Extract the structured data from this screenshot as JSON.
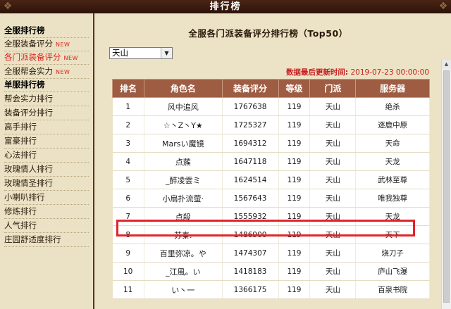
{
  "header": {
    "title": "排行榜"
  },
  "sidebar": {
    "items": [
      {
        "label": "全服排行榜",
        "head": true
      },
      {
        "label": "全服装备评分",
        "new": "NEW"
      },
      {
        "label": "各门派装备评分",
        "new": "NEW",
        "active": true
      },
      {
        "label": "全服帮会实力",
        "new": "NEW"
      },
      {
        "label": "单服排行榜",
        "head": true
      },
      {
        "label": "帮会实力排行"
      },
      {
        "label": "装备评分排行"
      },
      {
        "label": "高手排行"
      },
      {
        "label": "富豪排行"
      },
      {
        "label": "心法排行"
      },
      {
        "label": "玫瑰情人排行"
      },
      {
        "label": "玫瑰情圣排行"
      },
      {
        "label": "小喇叭排行"
      },
      {
        "label": "修炼排行"
      },
      {
        "label": "人气排行"
      },
      {
        "label": "庄园舒适度排行"
      }
    ]
  },
  "main": {
    "title": "全服各门派装备评分排行榜（Top50）",
    "sect_select": {
      "value": "天山"
    },
    "update_label": "数据最后更新时间:",
    "update_time": " 2019-07-23 00:00:00",
    "table": {
      "headers": [
        "排名",
        "角色名",
        "装备评分",
        "等级",
        "门派",
        "服务器"
      ],
      "rows": [
        [
          "1",
          "风中追风",
          "1767638",
          "119",
          "天山",
          "绝杀"
        ],
        [
          "2",
          "☆丶Z丶Y★",
          "1725327",
          "119",
          "天山",
          "逐鹿中原"
        ],
        [
          "3",
          "Marsい魔镜",
          "1694312",
          "119",
          "天山",
          "天命"
        ],
        [
          "4",
          "点蔟",
          "1647118",
          "119",
          "天山",
          "天龙"
        ],
        [
          "5",
          "_醉凌雲ミ",
          "1624514",
          "119",
          "天山",
          "武林至尊"
        ],
        [
          "6",
          "小扇扑流萤·",
          "1567643",
          "119",
          "天山",
          "唯我独尊"
        ],
        [
          "7",
          "点殺",
          "1555932",
          "119",
          "天山",
          "天龙"
        ],
        [
          "8",
          "苏秦.",
          "1486900",
          "119",
          "天山",
          "天下"
        ],
        [
          "9",
          "百里弥凉。や",
          "1474307",
          "119",
          "天山",
          "烧刀子"
        ],
        [
          "10",
          "_江風。い",
          "1418183",
          "119",
          "天山",
          "庐山飞瀑"
        ],
        [
          "11",
          "い丶一",
          "1366175",
          "119",
          "天山",
          "百泉书院"
        ]
      ]
    }
  },
  "colors": {
    "header_bar": "#3a1d10",
    "table_header": "#9e5c42",
    "accent_red": "#d9261c",
    "highlight": "#e0252a"
  }
}
